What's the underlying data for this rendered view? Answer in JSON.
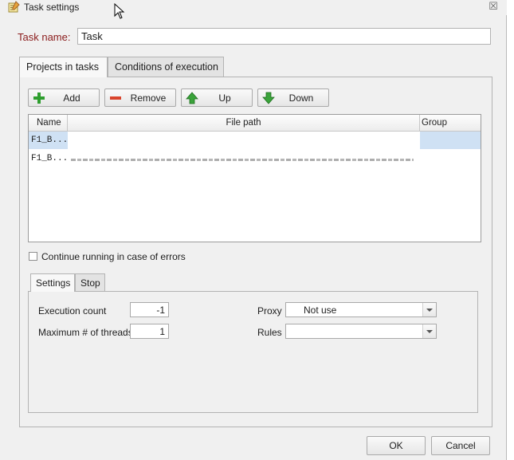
{
  "window": {
    "title": "Task settings",
    "close_glyph": "☒"
  },
  "task_name": {
    "label": "Task name:",
    "value": "Task"
  },
  "tabs": [
    {
      "label": "Projects in tasks",
      "selected": true
    },
    {
      "label": "Conditions of execution",
      "selected": false
    }
  ],
  "toolbar": {
    "add_label": "Add",
    "remove_label": "Remove",
    "up_label": "Up",
    "down_label": "Down"
  },
  "grid": {
    "columns": [
      "Name",
      "File path",
      "Group"
    ],
    "rows": [
      {
        "name": "F1_B...",
        "path": "",
        "group": "",
        "selected": true
      },
      {
        "name": "F1_B...",
        "path": "",
        "group": "",
        "selected": false
      }
    ]
  },
  "continue_on_errors": {
    "label": "Continue running in case of errors",
    "checked": false
  },
  "sub_tabs": [
    {
      "label": "Settings",
      "selected": true
    },
    {
      "label": "Stop",
      "selected": false
    }
  ],
  "settings": {
    "execution_count": {
      "label": "Execution count",
      "value": "-1"
    },
    "max_threads": {
      "label": "Maximum # of threads",
      "value": "1"
    },
    "proxy": {
      "label": "Proxy",
      "value": "Not use"
    },
    "rules": {
      "label": "Rules",
      "value": ""
    }
  },
  "buttons": {
    "ok_label": "OK",
    "cancel_label": "Cancel"
  },
  "colors": {
    "task_label": "#8a1b1b",
    "selection": "#cfe1f4",
    "add_icon": "#2e9e2e",
    "remove_icon": "#d9442c",
    "arrow_icon": "#3aa33a"
  }
}
